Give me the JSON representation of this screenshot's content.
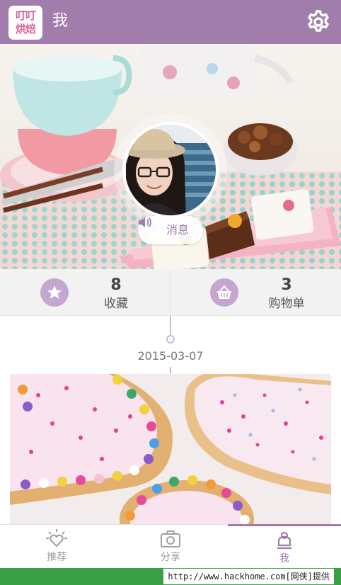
{
  "app": {
    "logo_text_line1": "叮叮",
    "logo_text_line2": "烘焙",
    "logo_color": "#d9669a"
  },
  "header": {
    "title": "我",
    "settings_icon": "gear-icon",
    "background": "#a07dab"
  },
  "cover": {
    "message_button": {
      "label": "消息",
      "icon": "speaker-icon"
    }
  },
  "stats": [
    {
      "icon": "star-icon",
      "value": "8",
      "label": "收藏"
    },
    {
      "icon": "basket-icon",
      "value": "3",
      "label": "购物单"
    }
  ],
  "timeline": {
    "date": "2015-03-07"
  },
  "tabs": [
    {
      "label": "推荐",
      "icon": "heart-sun-icon",
      "active": false
    },
    {
      "label": "分享",
      "icon": "camera-icon",
      "active": false
    },
    {
      "label": "我",
      "icon": "chef-hat-icon",
      "active": true
    }
  ],
  "watermark": {
    "text": "http://www.hackhome.com[网侠]提供"
  },
  "colors": {
    "accent": "#a07dab",
    "accent_light": "#c4a6d1",
    "watermark_bar": "#3aa048"
  }
}
